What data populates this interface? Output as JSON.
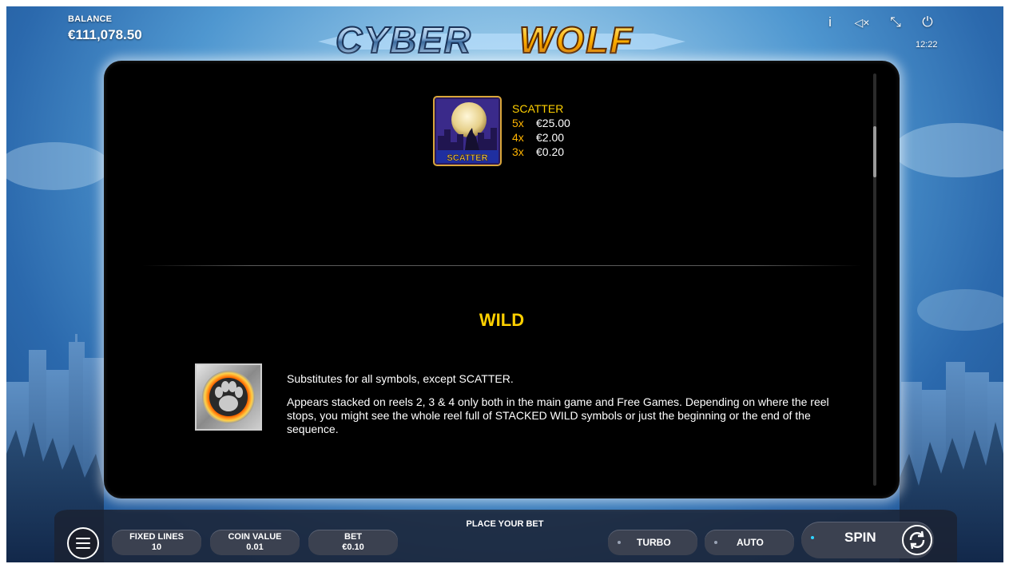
{
  "header": {
    "balance_label": "BALANCE",
    "balance_value": "€111,078.50",
    "logo_part1": "CYBER",
    "logo_part2": "WOLF",
    "time": "12:22",
    "icons": [
      "info-icon",
      "sound-muted-icon",
      "fullscreen-exit-icon",
      "power-icon"
    ],
    "info_glyph": "i",
    "mute_glyph": "◁×",
    "fullscreen_glyph": "⤡",
    "power_glyph": "⏻"
  },
  "paytable": {
    "scatter": {
      "symbol_label": "SCATTER",
      "name": "SCATTER",
      "payouts": [
        {
          "mult": "5x",
          "value": "€25.00"
        },
        {
          "mult": "4x",
          "value": "€2.00"
        },
        {
          "mult": "3x",
          "value": "€0.20"
        }
      ]
    },
    "wild": {
      "title": "WILD",
      "paragraph1": "Substitutes for all symbols, except SCATTER.",
      "paragraph2": "Appears stacked on reels 2, 3 & 4 only both in the main game and Free Games. Depending on where the reel stops, you might see the whole reel full of STACKED WILD symbols or just the beginning or the end of the sequence."
    }
  },
  "controls": {
    "place_bet": "PLACE YOUR BET",
    "fixed_lines_label": "FIXED LINES",
    "fixed_lines_value": "10",
    "coin_value_label": "COIN VALUE",
    "coin_value_value": "0.01",
    "bet_label": "BET",
    "bet_value": "€0.10",
    "turbo_label": "TURBO",
    "auto_label": "AUTO",
    "spin_label": "SPIN"
  },
  "colors": {
    "accent_gold": "#ffd000",
    "multiplier_orange": "#ffb400",
    "panel_bg": "#000000",
    "button_bg": "#3b4150",
    "spin_dot": "#2fd3ff"
  }
}
